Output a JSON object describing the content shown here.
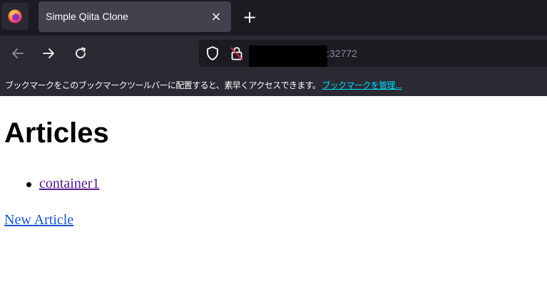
{
  "browser": {
    "tab": {
      "title": "Simple Qiita Clone",
      "close_label": "×"
    },
    "new_tab_label": "+",
    "address": {
      "visible_text": ":32772"
    },
    "bookmarks_bar": {
      "message": "ブックマークをこのブックマークツールバーに配置すると、素早くアクセスできます。",
      "manage_link": "ブックマークを管理..."
    },
    "colors": {
      "tabbar_bg": "#1c1b22",
      "toolbar_bg": "#2b2a33",
      "active_tab_bg": "#42414d",
      "link_cyan": "#00ddff"
    },
    "icons": [
      "firefox-icon",
      "close-icon",
      "plus-icon",
      "back-arrow-icon",
      "forward-arrow-icon",
      "reload-icon",
      "shield-icon",
      "insecure-lock-icon"
    ]
  },
  "page": {
    "title": "Articles",
    "articles": [
      {
        "title": "container1"
      }
    ],
    "new_article_label": "New Article",
    "colors": {
      "visited_link": "#551a8b",
      "link": "#1a56c8"
    }
  }
}
